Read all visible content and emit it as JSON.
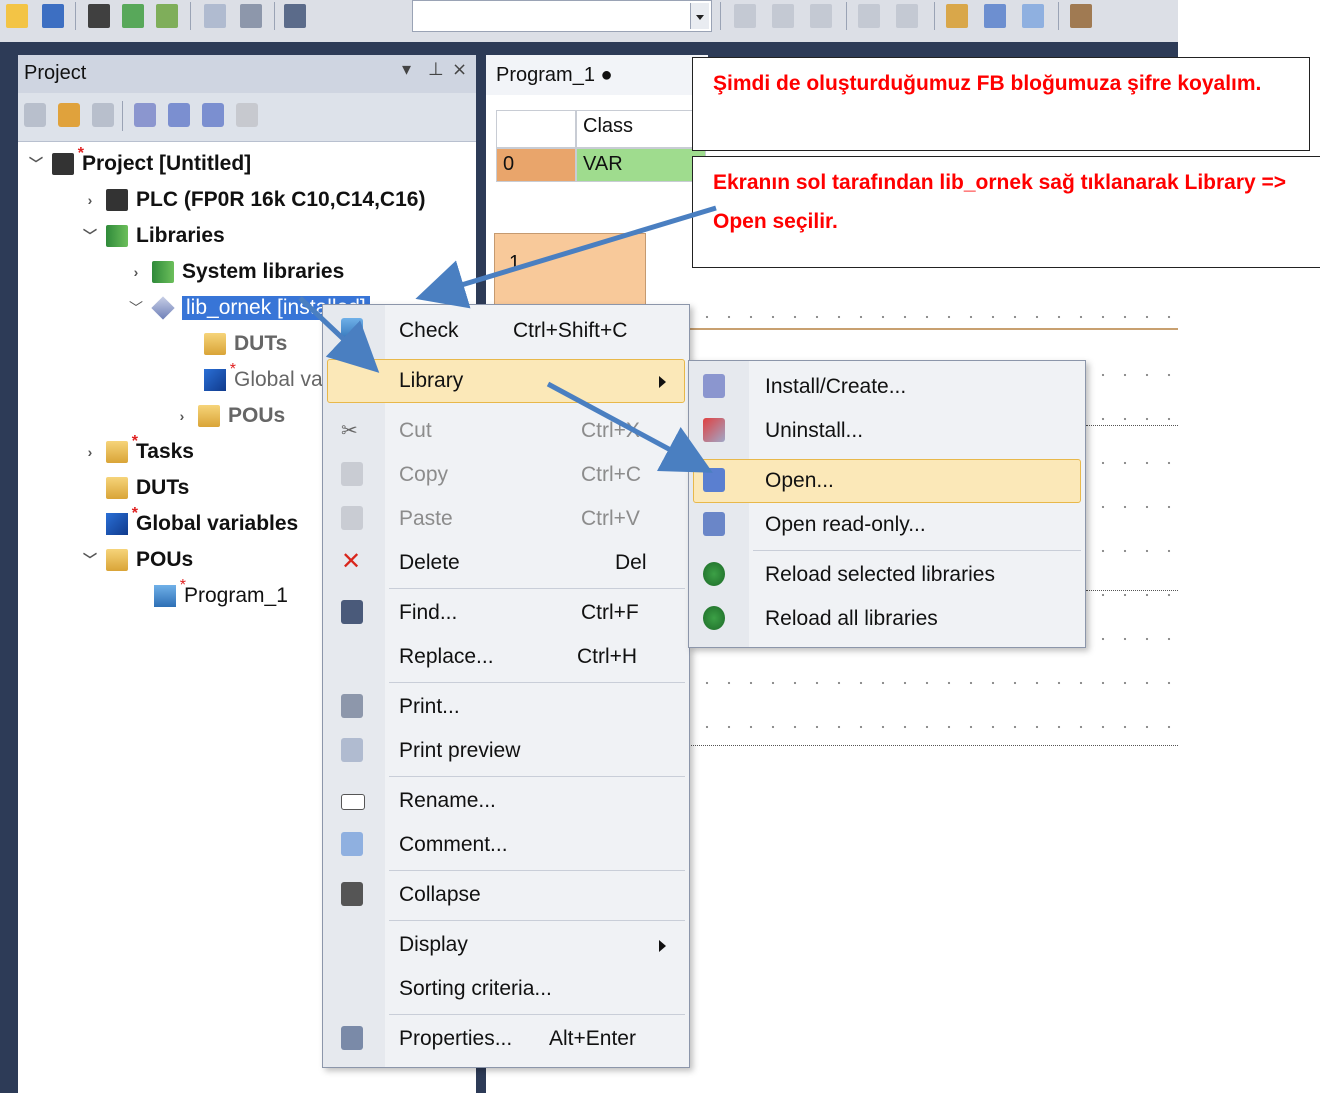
{
  "toolbar": {
    "icons": [
      "open-folder-icon",
      "save-icon",
      "plc-icon",
      "upload-icon",
      "download-icon",
      "print-preview-icon",
      "print-icon",
      "find-icon",
      "cut-icon",
      "copy-icon",
      "paste-icon",
      "undo-icon",
      "redo-icon",
      "check-icon",
      "compile-icon",
      "compile-all-icon",
      "monitor-icon"
    ]
  },
  "project_panel": {
    "title": "Project",
    "pin": "▾  ⊥  ×"
  },
  "tree": {
    "project": "Project [Untitled]",
    "plc": "PLC (FP0R 16k C10,C14,C16)",
    "libraries": "Libraries",
    "system_libraries": "System libraries",
    "lib_ornek": "lib_ornek [installed]",
    "lib_duts": "DUTs",
    "lib_global": "Global variables",
    "lib_pous": "POUs",
    "tasks": "Tasks",
    "duts": "DUTs",
    "global_variables": "Global variables",
    "pous": "POUs",
    "program_1": "Program_1"
  },
  "editor": {
    "tab_label": "Program_1 ●",
    "grid_header_class": "Class",
    "row_index": "0",
    "row_class": "VAR",
    "network_number": "1"
  },
  "callouts": {
    "top": "Şimdi de oluşturduğumuz FB bloğumuza şifre koyalım.",
    "bottom": "Ekranın sol tarafından lib_ornek  sağ tıklanarak Library => Open seçilir."
  },
  "context_menu": {
    "items": [
      {
        "label": "Check",
        "shortcut": "Ctrl+Shift+C"
      },
      {
        "label": "Library",
        "shortcut": ""
      },
      {
        "label": "Cut",
        "shortcut": "Ctrl+X"
      },
      {
        "label": "Copy",
        "shortcut": "Ctrl+C"
      },
      {
        "label": "Paste",
        "shortcut": "Ctrl+V"
      },
      {
        "label": "Delete",
        "shortcut": "Del"
      },
      {
        "label": "Find...",
        "shortcut": "Ctrl+F"
      },
      {
        "label": "Replace...",
        "shortcut": "Ctrl+H"
      },
      {
        "label": "Print...",
        "shortcut": ""
      },
      {
        "label": "Print preview",
        "shortcut": ""
      },
      {
        "label": "Rename...",
        "shortcut": ""
      },
      {
        "label": "Comment...",
        "shortcut": ""
      },
      {
        "label": "Collapse",
        "shortcut": ""
      },
      {
        "label": "Display",
        "shortcut": ""
      },
      {
        "label": "Sorting criteria...",
        "shortcut": ""
      },
      {
        "label": "Properties...",
        "shortcut": "Alt+Enter"
      }
    ]
  },
  "library_submenu": {
    "items": [
      {
        "label": "Install/Create..."
      },
      {
        "label": "Uninstall..."
      },
      {
        "label": "Open..."
      },
      {
        "label": "Open read-only..."
      },
      {
        "label": "Reload selected libraries"
      },
      {
        "label": "Reload all libraries"
      }
    ]
  },
  "colors": {
    "frame": "#2d3b57",
    "callout_text": "#ff0000",
    "arrow": "#4a7fc1",
    "highlight": "#fbe8b8",
    "network_fill": "#f8c99a",
    "var_green": "#9fdc8e"
  }
}
